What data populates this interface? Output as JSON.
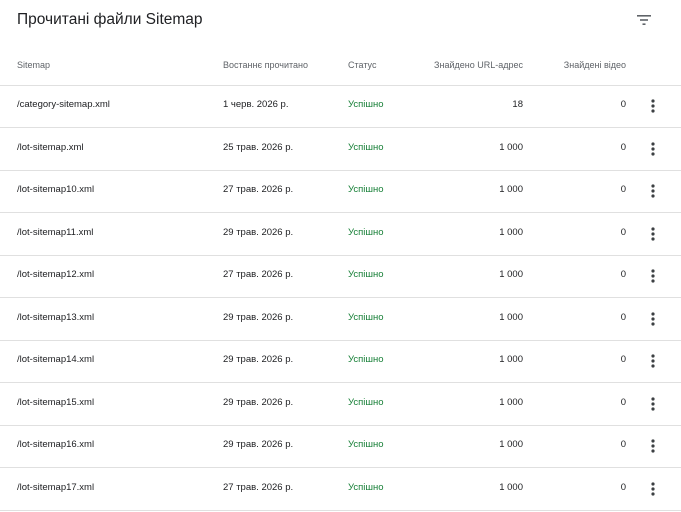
{
  "header": {
    "title": "Прочитані файли Sitemap",
    "filter_icon": "filter-list-icon"
  },
  "columns": {
    "sitemap": "Sitemap",
    "last_read": "Востаннє прочитано",
    "status": "Статус",
    "urls_found": "Знайдено URL-адрес",
    "videos_found": "Знайдені відео"
  },
  "colors": {
    "status_success": "#188038",
    "text": "#202124",
    "muted": "#5f6368",
    "divider": "#e0e0e0"
  },
  "rows": [
    {
      "sitemap": "/category-sitemap.xml",
      "date": "1 черв. 2026 р.",
      "status": "Успішно",
      "urls": "18",
      "videos": "0"
    },
    {
      "sitemap": "/lot-sitemap.xml",
      "date": "25 трав. 2026 р.",
      "status": "Успішно",
      "urls": "1 000",
      "videos": "0"
    },
    {
      "sitemap": "/lot-sitemap10.xml",
      "date": "27 трав. 2026 р.",
      "status": "Успішно",
      "urls": "1 000",
      "videos": "0"
    },
    {
      "sitemap": "/lot-sitemap11.xml",
      "date": "29 трав. 2026 р.",
      "status": "Успішно",
      "urls": "1 000",
      "videos": "0"
    },
    {
      "sitemap": "/lot-sitemap12.xml",
      "date": "27 трав. 2026 р.",
      "status": "Успішно",
      "urls": "1 000",
      "videos": "0"
    },
    {
      "sitemap": "/lot-sitemap13.xml",
      "date": "29 трав. 2026 р.",
      "status": "Успішно",
      "urls": "1 000",
      "videos": "0"
    },
    {
      "sitemap": "/lot-sitemap14.xml",
      "date": "29 трав. 2026 р.",
      "status": "Успішно",
      "urls": "1 000",
      "videos": "0"
    },
    {
      "sitemap": "/lot-sitemap15.xml",
      "date": "29 трав. 2026 р.",
      "status": "Успішно",
      "urls": "1 000",
      "videos": "0"
    },
    {
      "sitemap": "/lot-sitemap16.xml",
      "date": "29 трав. 2026 р.",
      "status": "Успішно",
      "urls": "1 000",
      "videos": "0"
    },
    {
      "sitemap": "/lot-sitemap17.xml",
      "date": "27 трав. 2026 р.",
      "status": "Успішно",
      "urls": "1 000",
      "videos": "0"
    }
  ]
}
